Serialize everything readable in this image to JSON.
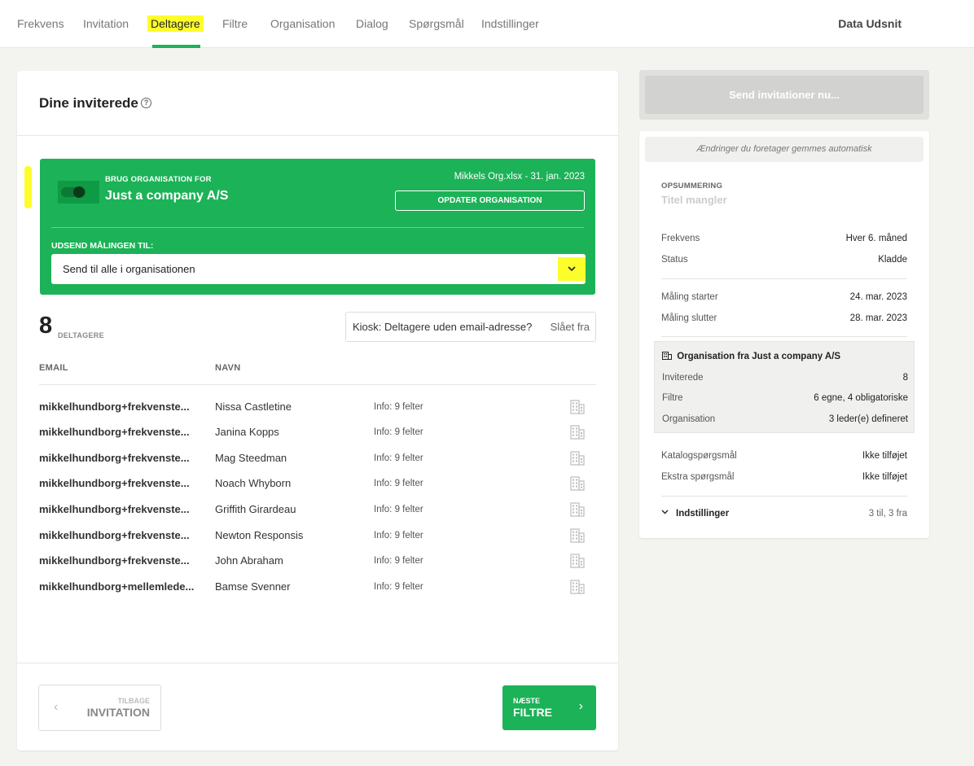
{
  "nav": {
    "tabs": [
      "Frekvens",
      "Invitation",
      "Deltagere",
      "Filtre",
      "Organisation",
      "Dialog",
      "Spørgsmål",
      "Indstillinger"
    ],
    "active_tab": "Deltagere",
    "data_udsnit": "Data Udsnit"
  },
  "main": {
    "title": "Dine inviterede",
    "help": "?"
  },
  "org": {
    "label": "BRUG ORGANISATION FOR",
    "name": "Just a company A/S",
    "file": "Mikkels Org.xlsx - 31. jan. 2023",
    "update_button": "OPDATER ORGANISATION",
    "send_label": "UDSEND MÅLINGEN TIL:",
    "send_value": "Send til alle i organisationen",
    "highlight_color": "#fdfd2c",
    "brand_color": "#1cb257"
  },
  "participants": {
    "count": "8",
    "count_label": "DELTAGERE",
    "kiosk_label": "Kiosk: Deltagere uden email-adresse?",
    "kiosk_status": "Slået fra",
    "columns": {
      "email": "EMAIL",
      "name": "NAVN"
    },
    "rows": [
      {
        "email": "mikkelhundborg+frekvenste...",
        "name": "Nissa Castletine",
        "info": "Info: 9 felter"
      },
      {
        "email": "mikkelhundborg+frekvenste...",
        "name": "Janina Kopps",
        "info": "Info: 9 felter"
      },
      {
        "email": "mikkelhundborg+frekvenste...",
        "name": "Mag Steedman",
        "info": "Info: 9 felter"
      },
      {
        "email": "mikkelhundborg+frekvenste...",
        "name": "Noach Whyborn",
        "info": "Info: 9 felter"
      },
      {
        "email": "mikkelhundborg+frekvenste...",
        "name": "Griffith Girardeau",
        "info": "Info: 9 felter"
      },
      {
        "email": "mikkelhundborg+frekvenste...",
        "name": "Newton Responsis",
        "info": "Info: 9 felter"
      },
      {
        "email": "mikkelhundborg+frekvenste...",
        "name": "John Abraham",
        "info": "Info: 9 felter"
      },
      {
        "email": "mikkelhundborg+mellemlede...",
        "name": "Bamse Svenner",
        "info": "Info: 9 felter"
      }
    ]
  },
  "footer": {
    "back_small": "TILBAGE",
    "back_big": "INVITATION",
    "next_small": "NÆSTE",
    "next_big": "FILTRE"
  },
  "side": {
    "send_button": "Send invitationer nu...",
    "autosave": "Ændringer du foretager gemmes automatisk",
    "summary_label": "OPSUMMERING",
    "summary_title": "Titel mangler",
    "frekvens": {
      "k": "Frekvens",
      "v": "Hver 6. måned"
    },
    "status": {
      "k": "Status",
      "v": "Kladde"
    },
    "start": {
      "k": "Måling starter",
      "v": "24. mar. 2023"
    },
    "end": {
      "k": "Måling slutter",
      "v": "28. mar. 2023"
    },
    "org_head": "Organisation fra Just a company A/S",
    "inviterede": {
      "k": "Inviterede",
      "v": "8"
    },
    "filtre": {
      "k": "Filtre",
      "v": "6 egne, 4 obligatoriske"
    },
    "organisation": {
      "k": "Organisation",
      "v": "3 leder(e) defineret"
    },
    "katalog": {
      "k": "Katalogspørgsmål",
      "v": "Ikke tilføjet"
    },
    "ekstra": {
      "k": "Ekstra spørgsmål",
      "v": "Ikke tilføjet"
    },
    "settings": {
      "k": "Indstillinger",
      "v": "3 til, 3 fra"
    }
  }
}
